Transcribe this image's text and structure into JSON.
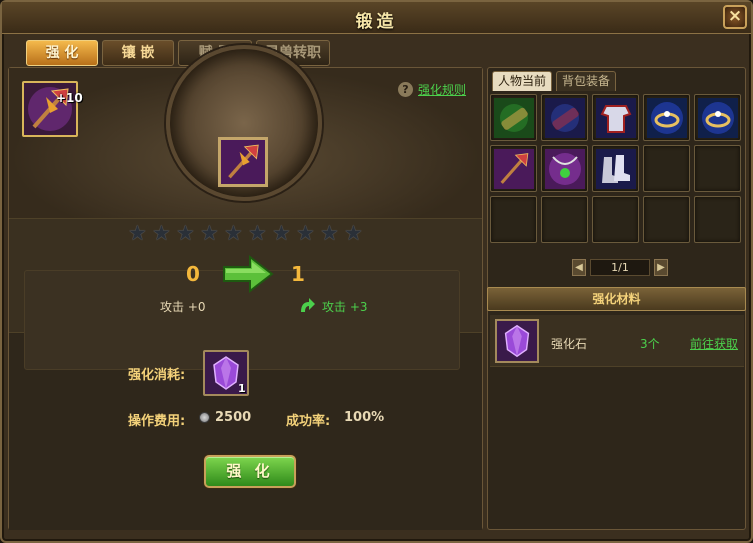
{
  "window": {
    "title": "锻造",
    "close_glyph": "×"
  },
  "tabs": [
    {
      "label": "强 化",
      "state": "active"
    },
    {
      "label": "镶 嵌",
      "state": "highlight"
    },
    {
      "label": "赋 属",
      "state": "inactive"
    },
    {
      "label": "灵兽转职",
      "state": "inactive"
    }
  ],
  "equipped": {
    "icon": "axe-weapon-icon",
    "enhance_level": "+10"
  },
  "help": {
    "glyph": "?",
    "rule_link": "强化规则"
  },
  "stars": {
    "total": 10,
    "filled": 0,
    "glyph": "★"
  },
  "upgrade": {
    "from_level": "0",
    "to_level": "1",
    "attack_from": "攻击 +0",
    "attack_to": "攻击 +3"
  },
  "cost": {
    "consume_label": "强化消耗:",
    "gem_icon": "purple-gem-icon",
    "gem_count": "1",
    "fee_label": "操作费用:",
    "fee_value": "2500",
    "rate_label": "成功率:",
    "rate_value": "100%"
  },
  "forge_button": {
    "label": "强 化"
  },
  "inventory": {
    "tabs": [
      {
        "label": "人物当前",
        "state": "active"
      },
      {
        "label": "背包装备",
        "state": "inactive"
      }
    ],
    "items": [
      "green-scroll-icon",
      "red-scroll-icon",
      "armor-icon",
      "ring-icon",
      "ring-icon",
      "axe-weapon-icon",
      "amulet-icon",
      "boots-icon",
      "",
      "",
      "",
      "",
      "",
      "",
      ""
    ],
    "pager": {
      "prev": "◀",
      "next": "▶",
      "text": "1/1"
    }
  },
  "materials": {
    "header": "强化材料",
    "items": [
      {
        "icon": "purple-gem-icon",
        "name": "强化石",
        "count": "3个",
        "link": "前往获取"
      }
    ]
  },
  "colors": {
    "accent_gold": "#f4b83c",
    "positive_green": "#4cd04c",
    "label_gold": "#f4d27a"
  }
}
